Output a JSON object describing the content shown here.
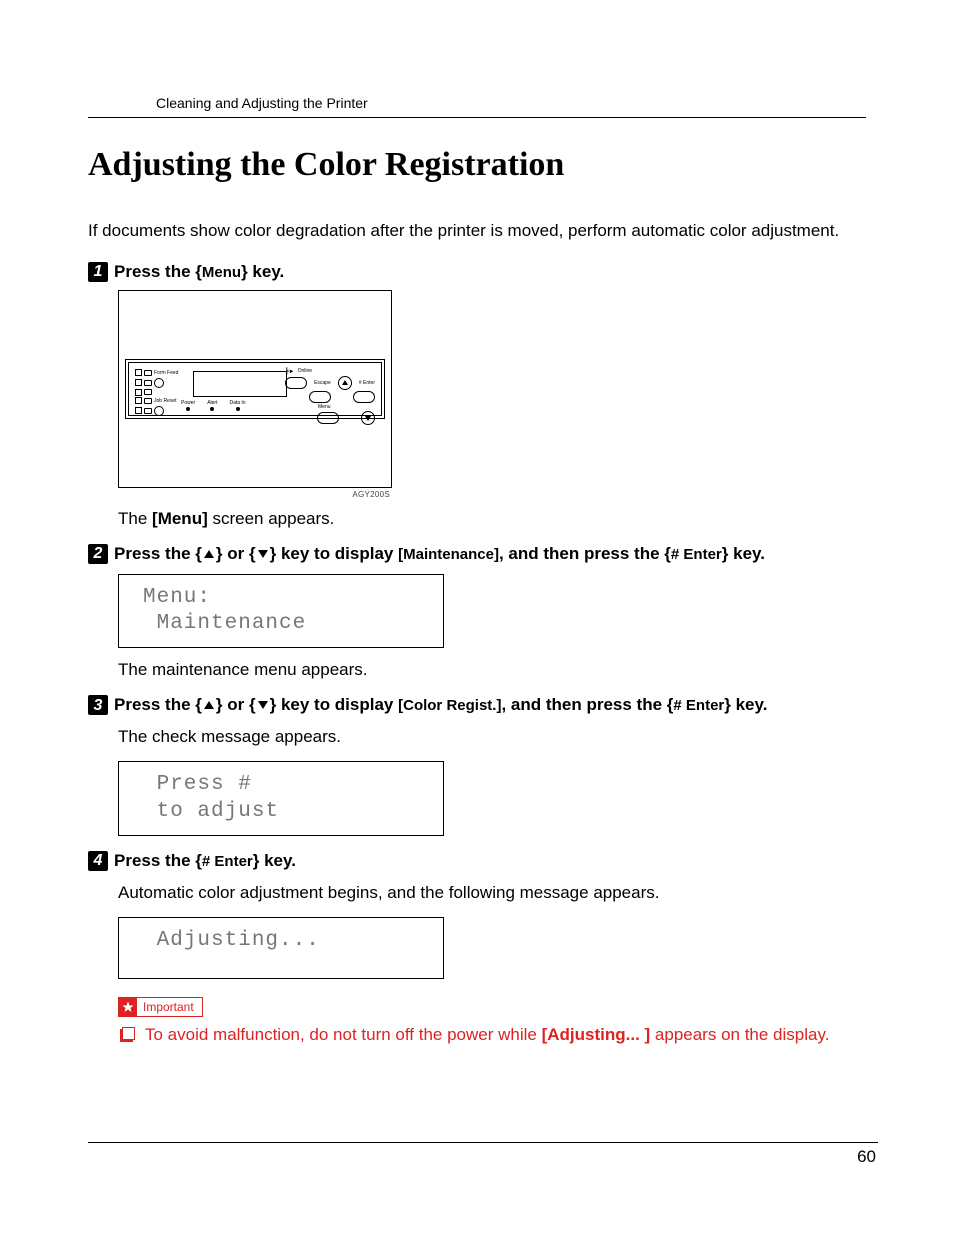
{
  "header": {
    "running_head": "Cleaning and Adjusting the Printer"
  },
  "title": "Adjusting the Color Registration",
  "intro": "If documents show color degradation after the printer is moved, perform automatic color adjustment.",
  "keys": {
    "menu": "Menu",
    "enter": "# Enter",
    "maintenance": "Maintenance",
    "color_regist": "Color Regist.",
    "adjusting_bold": "Adjusting..."
  },
  "steps": {
    "s1": {
      "num": "1",
      "pre": "Press the ",
      "post": " key.",
      "after_fig": "The ",
      "after_fig_bold": "[Menu]",
      "after_fig_tail": " screen appears."
    },
    "s2": {
      "num": "2",
      "pre": "Press the ",
      "mid": " or ",
      "mid2": " key to display ",
      "mid3": ", and then press the ",
      "post": " key.",
      "after": "The maintenance menu appears."
    },
    "s3": {
      "num": "3",
      "pre": "Press the ",
      "mid": " or ",
      "mid2": " key to display ",
      "mid3": ", and then press the ",
      "post": " key.",
      "after": "The check message appears."
    },
    "s4": {
      "num": "4",
      "pre": "Press the ",
      "post": " key.",
      "after": "Automatic color adjustment begins, and the following message appears."
    }
  },
  "lcd": {
    "menu_maint": "Menu:\n Maintenance",
    "press_adjust": " Press #\n to adjust",
    "adjusting": " Adjusting..."
  },
  "panel": {
    "form_feed": "Form Feed",
    "job_reset": "Job Reset",
    "power": "Power",
    "alert": "Alert",
    "data_in": "Data In",
    "online": "Online",
    "escape": "Escape",
    "menu": "Menu",
    "enter": "# Enter",
    "fig_code": "AGY200S"
  },
  "important": {
    "label": "Important",
    "text_pre": "To avoid malfunction, do not turn off the power while ",
    "text_bold": "[Adjusting... ]",
    "text_post": " appears on the display."
  },
  "page_number": "60"
}
